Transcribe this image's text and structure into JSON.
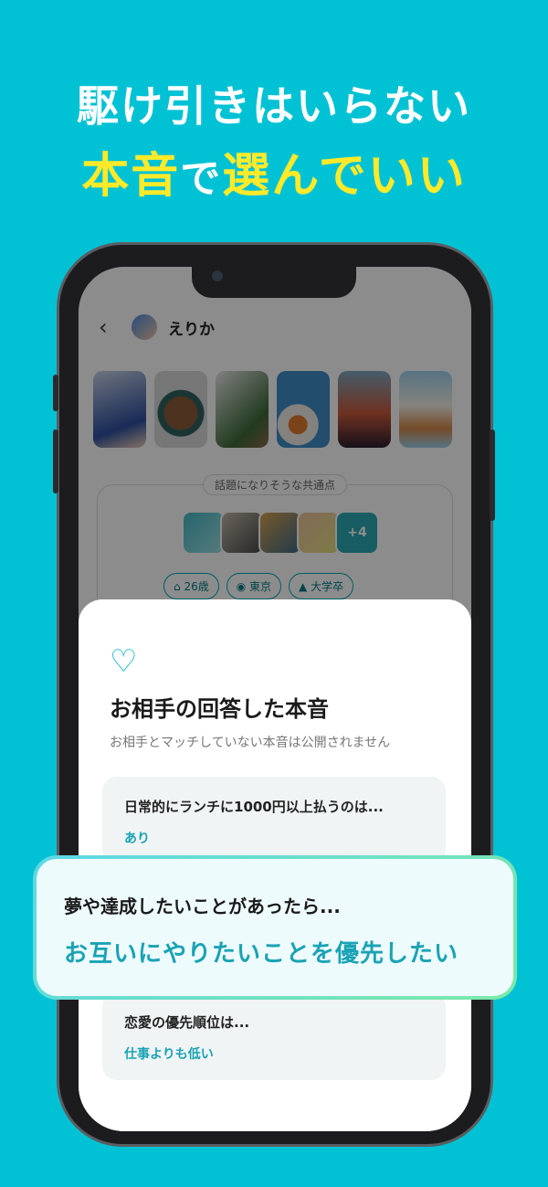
{
  "headline": {
    "line1": "駆け引きはいらない",
    "line2_a": "本音",
    "line2_b": "で",
    "line2_c": "選んでいい"
  },
  "profile": {
    "name": "えりか"
  },
  "common": {
    "label": "話題になりそうな共通点",
    "more_count": "+4",
    "tags": [
      "26歳",
      "東京",
      "大学卒"
    ]
  },
  "sheet": {
    "title": "お相手の回答した本音",
    "subtitle": "お相手とマッチしていない本音は公開されません",
    "answers": [
      {
        "question": "日常的にランチに1000円以上払うのは...",
        "answer": "あり"
      },
      {
        "question": "恋愛の優先順位は...",
        "answer": "仕事よりも低い"
      }
    ]
  },
  "bubble": {
    "question": "夢や達成したいことがあったら...",
    "answer": "お互いにやりたいことを優先したい"
  },
  "colors": {
    "background": "#00c2d4",
    "accent_yellow": "#ffea2a",
    "accent_teal": "#1aa3b5"
  },
  "icons": [
    "chevron-left-icon",
    "heart-logo-icon",
    "cake-icon",
    "location-pin-icon",
    "graduation-cap-icon"
  ]
}
